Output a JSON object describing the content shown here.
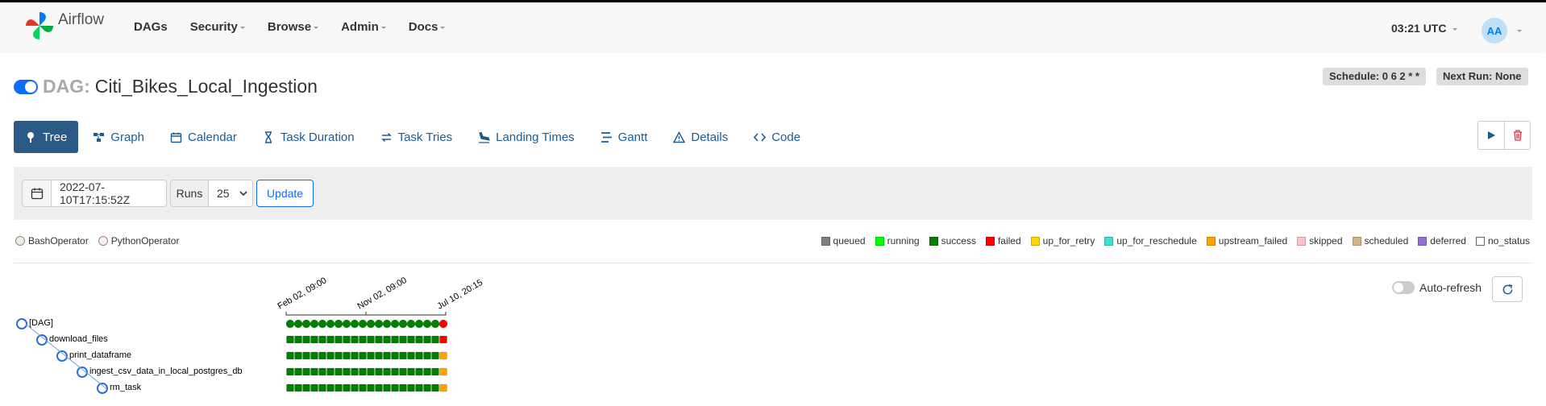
{
  "header": {
    "brand": "Airflow",
    "nav": [
      {
        "label": "DAGs",
        "caret": false
      },
      {
        "label": "Security",
        "caret": true
      },
      {
        "label": "Browse",
        "caret": true
      },
      {
        "label": "Admin",
        "caret": true
      },
      {
        "label": "Docs",
        "caret": true
      }
    ],
    "clock": "03:21 UTC",
    "avatar": "AA"
  },
  "dag": {
    "prefix": "DAG:",
    "name": "Citi_Bikes_Local_Ingestion",
    "paused": false,
    "schedule": "Schedule: 0 6 2 * *",
    "next_run": "Next Run: None"
  },
  "tabs": [
    {
      "label": "Tree",
      "icon": "tree-icon",
      "active": true
    },
    {
      "label": "Graph",
      "icon": "graph-icon",
      "active": false
    },
    {
      "label": "Calendar",
      "icon": "calendar-icon",
      "active": false
    },
    {
      "label": "Task Duration",
      "icon": "hourglass-icon",
      "active": false
    },
    {
      "label": "Task Tries",
      "icon": "retry-icon",
      "active": false
    },
    {
      "label": "Landing Times",
      "icon": "plane-landing-icon",
      "active": false
    },
    {
      "label": "Gantt",
      "icon": "gantt-icon",
      "active": false
    },
    {
      "label": "Details",
      "icon": "warning-icon",
      "active": false
    },
    {
      "label": "Code",
      "icon": "code-icon",
      "active": false
    }
  ],
  "filters": {
    "base_date": "2022-07-10T17:15:52Z",
    "runs_label": "Runs",
    "runs_value": "25",
    "update_label": "Update"
  },
  "operators": [
    {
      "label": "BashOperator",
      "color": "#f0ede4"
    },
    {
      "label": "PythonOperator",
      "color": "#ffefeb"
    }
  ],
  "states": [
    {
      "label": "queued",
      "color": "#808080"
    },
    {
      "label": "running",
      "color": "#00ff00"
    },
    {
      "label": "success",
      "color": "#008000"
    },
    {
      "label": "failed",
      "color": "#ff0000"
    },
    {
      "label": "up_for_retry",
      "color": "#ffd700"
    },
    {
      "label": "up_for_reschedule",
      "color": "#40e0d0"
    },
    {
      "label": "upstream_failed",
      "color": "#ffa500"
    },
    {
      "label": "skipped",
      "color": "#ffc0cb"
    },
    {
      "label": "scheduled",
      "color": "#d2b48c"
    },
    {
      "label": "deferred",
      "color": "#9370db"
    },
    {
      "label": "no_status",
      "color": "#ffffff"
    }
  ],
  "auto_refresh": {
    "label": "Auto-refresh",
    "enabled": false
  },
  "tree": {
    "date_ticks": [
      "Feb 02, 09:00",
      "Nov 02, 09:00",
      "Jul 10, 20:15"
    ],
    "tasks": [
      {
        "label": "[DAG]",
        "depth": 0,
        "shape": "circle",
        "runs": [
          "success",
          "success",
          "success",
          "success",
          "success",
          "success",
          "success",
          "success",
          "success",
          "success",
          "success",
          "success",
          "success",
          "success",
          "success",
          "success",
          "success",
          "success",
          "success",
          "failed"
        ]
      },
      {
        "label": "download_files",
        "depth": 1,
        "shape": "square",
        "runs": [
          "success",
          "success",
          "success",
          "success",
          "success",
          "success",
          "success",
          "success",
          "success",
          "success",
          "success",
          "success",
          "success",
          "success",
          "success",
          "success",
          "success",
          "success",
          "success",
          "failed"
        ]
      },
      {
        "label": "print_dataframe",
        "depth": 2,
        "shape": "square",
        "runs": [
          "success",
          "success",
          "success",
          "success",
          "success",
          "success",
          "success",
          "success",
          "success",
          "success",
          "success",
          "success",
          "success",
          "success",
          "success",
          "success",
          "success",
          "success",
          "success",
          "upstream_failed"
        ]
      },
      {
        "label": "ingest_csv_data_in_local_postgres_db",
        "depth": 3,
        "shape": "square",
        "runs": [
          "success",
          "success",
          "success",
          "success",
          "success",
          "success",
          "success",
          "success",
          "success",
          "success",
          "success",
          "success",
          "success",
          "success",
          "success",
          "success",
          "success",
          "success",
          "success",
          "upstream_failed"
        ]
      },
      {
        "label": "rm_task",
        "depth": 4,
        "shape": "square",
        "runs": [
          "success",
          "success",
          "success",
          "success",
          "success",
          "success",
          "success",
          "success",
          "success",
          "success",
          "success",
          "success",
          "success",
          "success",
          "success",
          "success",
          "success",
          "success",
          "success",
          "upstream_failed"
        ]
      }
    ]
  }
}
